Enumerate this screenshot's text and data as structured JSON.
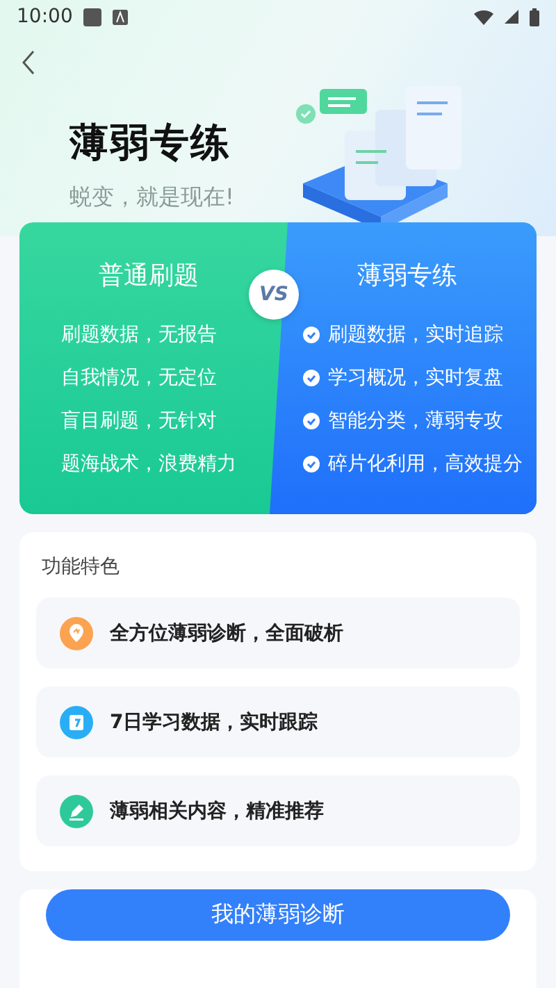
{
  "status_bar": {
    "time": "10:00"
  },
  "header": {
    "title": "薄弱专练",
    "subtitle": "蜕变，就是现在!"
  },
  "comparison": {
    "left": {
      "title": "普通刷题",
      "items": [
        "刷题数据，无报告",
        "自我情况，无定位",
        "盲目刷题，无针对",
        "题海战术，浪费精力"
      ]
    },
    "vs": "VS",
    "right": {
      "title": "薄弱专练",
      "items": [
        "刷题数据，实时追踪",
        "学习概况，实时复盘",
        "智能分类，薄弱专攻",
        "碎片化利用，高效提分"
      ]
    }
  },
  "features": {
    "title": "功能特色",
    "items": [
      {
        "kind": "diagnosis",
        "text": "全方位薄弱诊断，全面破析"
      },
      {
        "kind": "calendar",
        "text": "7日学习数据，实时跟踪"
      },
      {
        "kind": "recommend",
        "text": "薄弱相关内容，精准推荐"
      }
    ]
  },
  "action_button": {
    "label": "我的薄弱诊断"
  }
}
